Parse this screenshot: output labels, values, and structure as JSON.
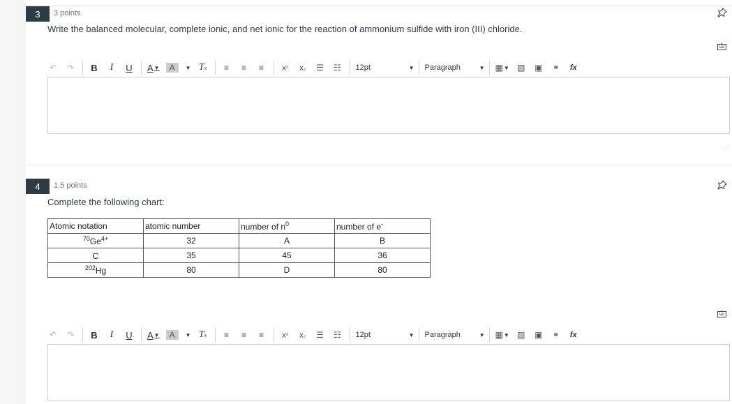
{
  "questions": [
    {
      "number": "3",
      "points": "3 points",
      "prompt": "Write the balanced molecular, complete ionic, and net ionic for the reaction of ammonium sulfide with iron (III) chloride.",
      "toolbar": {
        "font_size": "12pt",
        "block_format": "Paragraph"
      }
    },
    {
      "number": "4",
      "points": "1.5 points",
      "prompt": "Complete the following chart:",
      "table": {
        "headers": [
          "Atomic notation",
          "atomic number",
          "number of n",
          "number of e"
        ],
        "header_sups": [
          "",
          "",
          "0",
          "-"
        ],
        "rows": [
          {
            "mass": "70",
            "symbol": "Ge",
            "charge": "4+",
            "atomic_number": "32",
            "neutrons": "A",
            "electrons": "B"
          },
          {
            "mass": "",
            "symbol": "C",
            "charge": "",
            "atomic_number": "35",
            "neutrons": "45",
            "electrons": "36"
          },
          {
            "mass": "202",
            "symbol": "Hg",
            "charge": "",
            "atomic_number": "80",
            "neutrons": "D",
            "electrons": "80"
          }
        ]
      },
      "toolbar": {
        "font_size": "12pt",
        "block_format": "Paragraph"
      }
    }
  ],
  "icons": {
    "undo": "undo-icon",
    "redo": "redo-icon",
    "bold": "B",
    "italic": "I",
    "underline": "U",
    "text_color": "A",
    "bg_color": "A",
    "clear_format": "Tx",
    "superscript": "x²",
    "subscript": "x₂",
    "pin": "pin-icon",
    "keyboard": "keyboard-icon"
  }
}
